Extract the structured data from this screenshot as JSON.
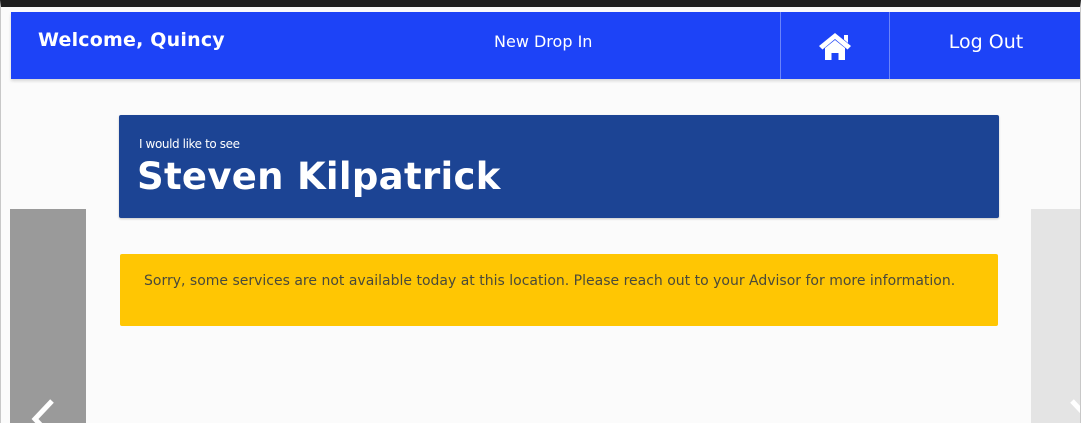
{
  "header": {
    "welcome": "Welcome, Quincy",
    "title": "New Drop In",
    "home_icon": "home-icon",
    "logout_label": "Log Out"
  },
  "visit": {
    "intro": "I would like to see",
    "advisor_name": "Steven Kilpatrick"
  },
  "notice": {
    "message": "Sorry, some services are not available today at this location. Please reach out to your Advisor for more information."
  },
  "carousel": {
    "prev_icon": "chevron-left-icon",
    "next_icon": "chevron-right-icon"
  },
  "colors": {
    "topbar": "#1d43f7",
    "card": "#1c4494",
    "notice": "#ffc603"
  }
}
